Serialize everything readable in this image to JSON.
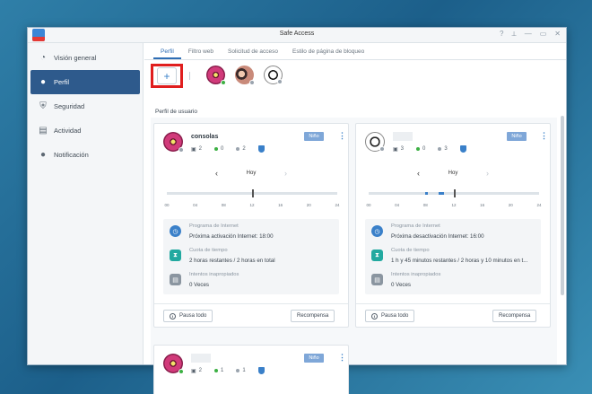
{
  "window": {
    "title": "Safe Access"
  },
  "sidebar": {
    "items": [
      {
        "label": "Visión general",
        "icon": "dashboard-icon",
        "active": false
      },
      {
        "label": "Perfil",
        "icon": "person-icon",
        "active": true
      },
      {
        "label": "Seguridad",
        "icon": "shield-icon",
        "active": false
      },
      {
        "label": "Actividad",
        "icon": "document-icon",
        "active": false
      },
      {
        "label": "Notificación",
        "icon": "chat-bubble-icon",
        "active": false
      }
    ]
  },
  "tabs": [
    {
      "label": "Perfil",
      "active": true
    },
    {
      "label": "Filtro web",
      "active": false
    },
    {
      "label": "Solicitud de acceso",
      "active": false
    },
    {
      "label": "Estilo de página de bloqueo",
      "active": false
    }
  ],
  "profile_bar": {
    "add_label": "+"
  },
  "section_title": "Perfil de usuario",
  "colors": {
    "accent": "#2e6db4",
    "active_sidebar": "#2e5a8c",
    "highlight_border": "#e01e1e",
    "online": "#3cb043",
    "offline": "#9aa4ae"
  },
  "cards": [
    {
      "name": "consolas",
      "badge": "Niño",
      "devices": "2",
      "online": "0",
      "offline": "2",
      "day_label": "Hoy",
      "ticks": [
        "00",
        "04",
        "08",
        "12",
        "16",
        "20",
        "24"
      ],
      "schedule_title": "Programa de Internet",
      "schedule_value": "Próxima activación Internet: 18:00",
      "quota_title": "Cuota de tiempo",
      "quota_value": "2 horas restantes / 2 horas en total",
      "attempts_title": "Intentos inapropiados",
      "attempts_value": "0 Veces",
      "pause_label": "Pausa todo",
      "reward_label": "Recompensa"
    },
    {
      "name": "",
      "badge": "Niño",
      "devices": "3",
      "online": "0",
      "offline": "3",
      "day_label": "Hoy",
      "ticks": [
        "00",
        "04",
        "08",
        "12",
        "16",
        "20",
        "24"
      ],
      "schedule_title": "Programa de Internet",
      "schedule_value": "Próxima desactivación Internet: 16:00",
      "quota_title": "Cuota de tiempo",
      "quota_value": "1 h y 45 minutos restantes / 2 horas y 10 minutos en t...",
      "attempts_title": "Intentos inapropiados",
      "attempts_value": "0 Veces",
      "pause_label": "Pausa todo",
      "reward_label": "Recompensa"
    },
    {
      "name": "",
      "badge": "Niño",
      "devices": "2",
      "online": "1",
      "offline": "1"
    }
  ]
}
